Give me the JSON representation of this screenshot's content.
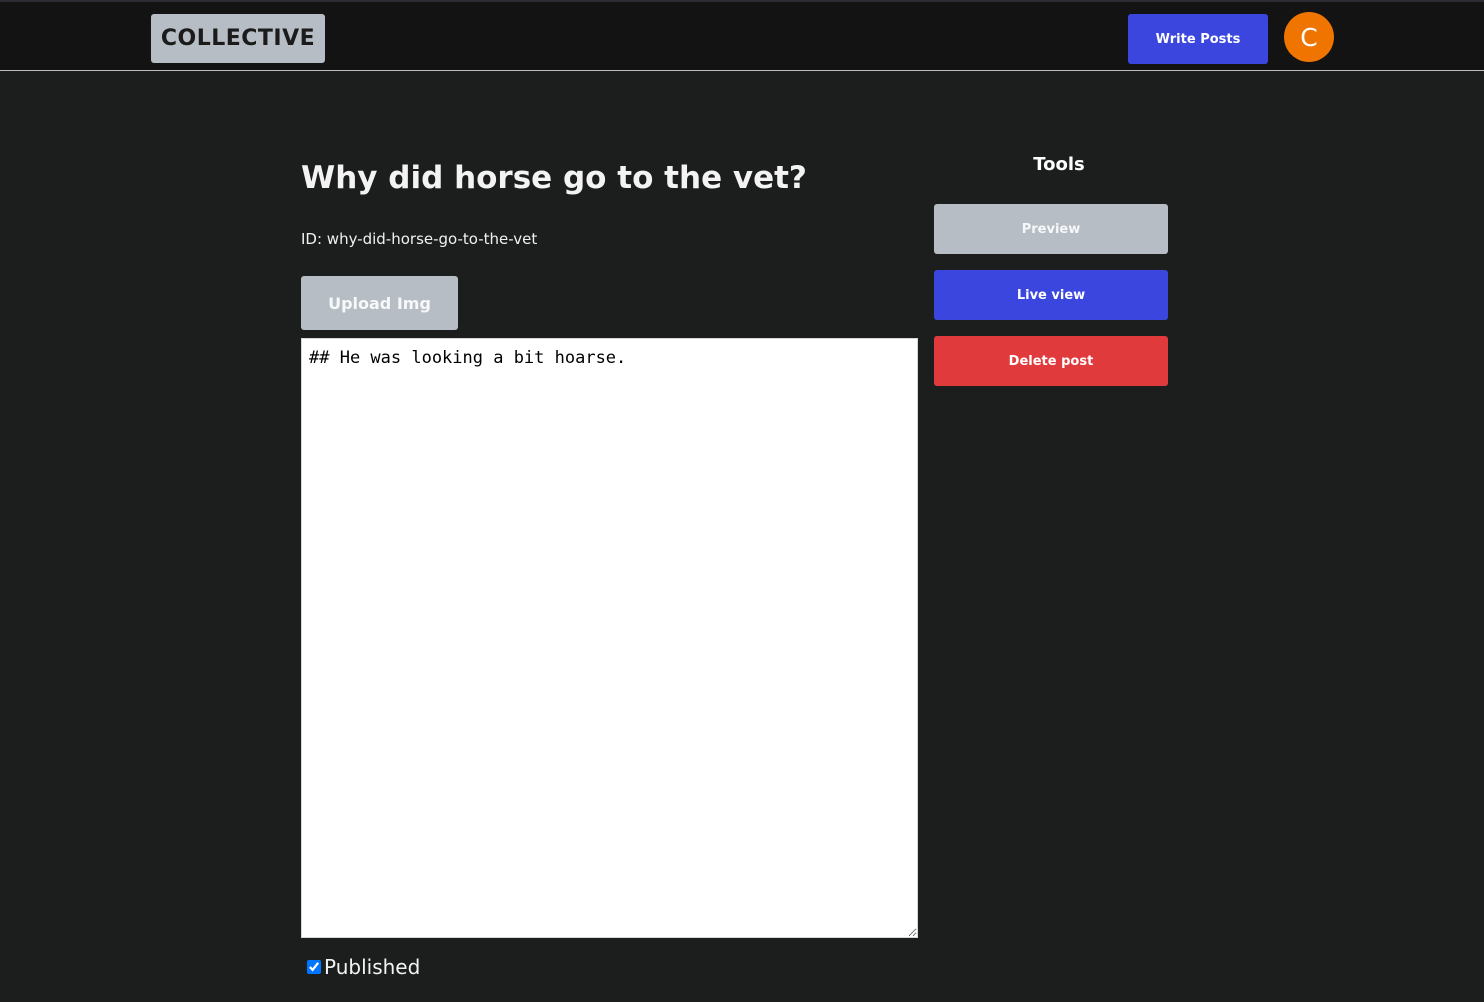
{
  "header": {
    "logo": "COLLECTIVE",
    "write_posts_label": "Write Posts",
    "avatar_initial": "C"
  },
  "post": {
    "title": "Why did horse go to the vet?",
    "id_line": "ID: why-did-horse-go-to-the-vet",
    "upload_label": "Upload Img",
    "body": "## He was looking a bit hoarse.",
    "published_label": "Published",
    "published": true
  },
  "tools": {
    "heading": "Tools",
    "preview_label": "Preview",
    "live_view_label": "Live view",
    "delete_label": "Delete post"
  },
  "colors": {
    "background": "#1c1e1e",
    "topbar": "#131313",
    "primary": "#3b46df",
    "secondary": "#b6bdc4",
    "danger": "#e03a3c",
    "avatar": "#f07400"
  }
}
